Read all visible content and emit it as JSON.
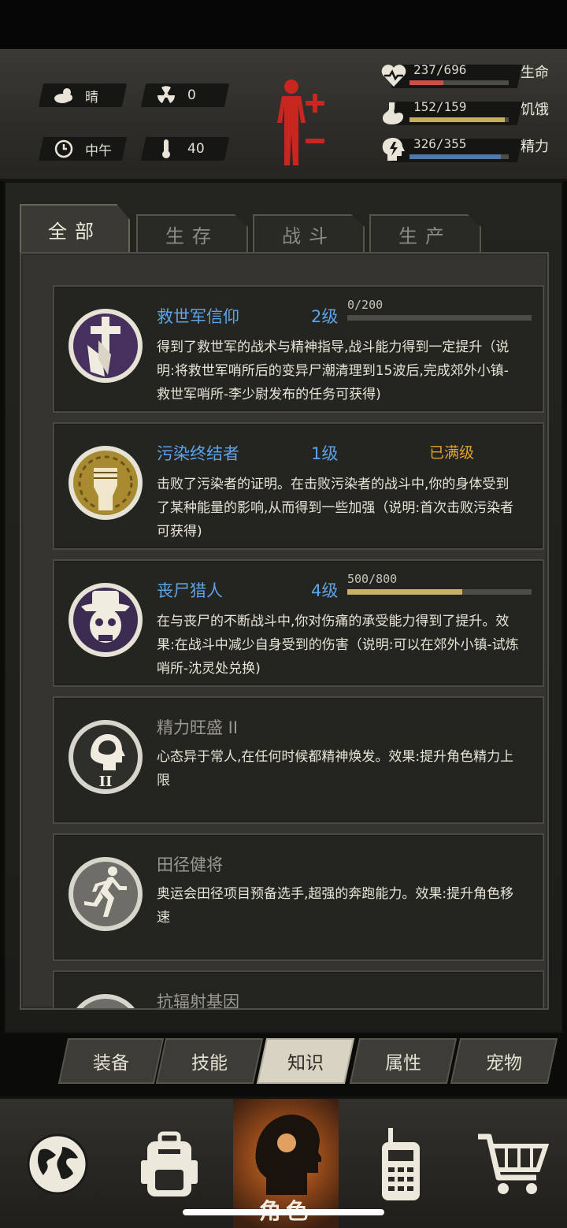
{
  "hud": {
    "weather": "晴",
    "radiation": "0",
    "time_of_day": "中午",
    "temperature": "40",
    "stats": [
      {
        "value": "237/696",
        "label": "生命",
        "fraction": 0.34,
        "color": "#c8513f"
      },
      {
        "value": "152/159",
        "label": "饥饿",
        "fraction": 0.96,
        "color": "#c5ad62"
      },
      {
        "value": "326/355",
        "label": "精力",
        "fraction": 0.92,
        "color": "#4d79ad"
      }
    ]
  },
  "tabs": [
    "全部",
    "生存",
    "战斗",
    "生产"
  ],
  "cards": [
    {
      "title": "救世军信仰",
      "level": "2级",
      "progress_text": "0/200",
      "progress": 0.0,
      "desc": "得到了救世军的战术与精神指导,战斗能力得到一定提升（说明:将救世军哨所后的变异尸潮清理到15波后,完成郊外小镇-救世军哨所-李少尉发布的任务可获得)"
    },
    {
      "title": "污染终结者",
      "level": "1级",
      "maxed": "已满级",
      "desc": "击败了污染者的证明。在击败污染者的战斗中,你的身体受到了某种能量的影响,从而得到一些加强（说明:首次击败污染者可获得)"
    },
    {
      "title": "丧尸猎人",
      "level": "4级",
      "progress_text": "500/800",
      "progress": 0.625,
      "desc": "在与丧尸的不断战斗中,你对伤痛的承受能力得到了提升。效果:在战斗中减少自身受到的伤害（说明:可以在郊外小镇-试炼哨所-沈灵处兑换)"
    },
    {
      "title": "精力旺盛 II",
      "desc": "心态异于常人,在任何时候都精神焕发。效果:提升角色精力上限"
    },
    {
      "title": "田径健将",
      "desc": "奥运会田径项目预备选手,超强的奔跑能力。效果:提升角色移速"
    },
    {
      "title": "抗辐射基因",
      "desc": ""
    }
  ],
  "subtabs": [
    "装备",
    "技能",
    "知识",
    "属性",
    "宠物"
  ],
  "bottom_nav": {
    "active_label": "角色"
  }
}
